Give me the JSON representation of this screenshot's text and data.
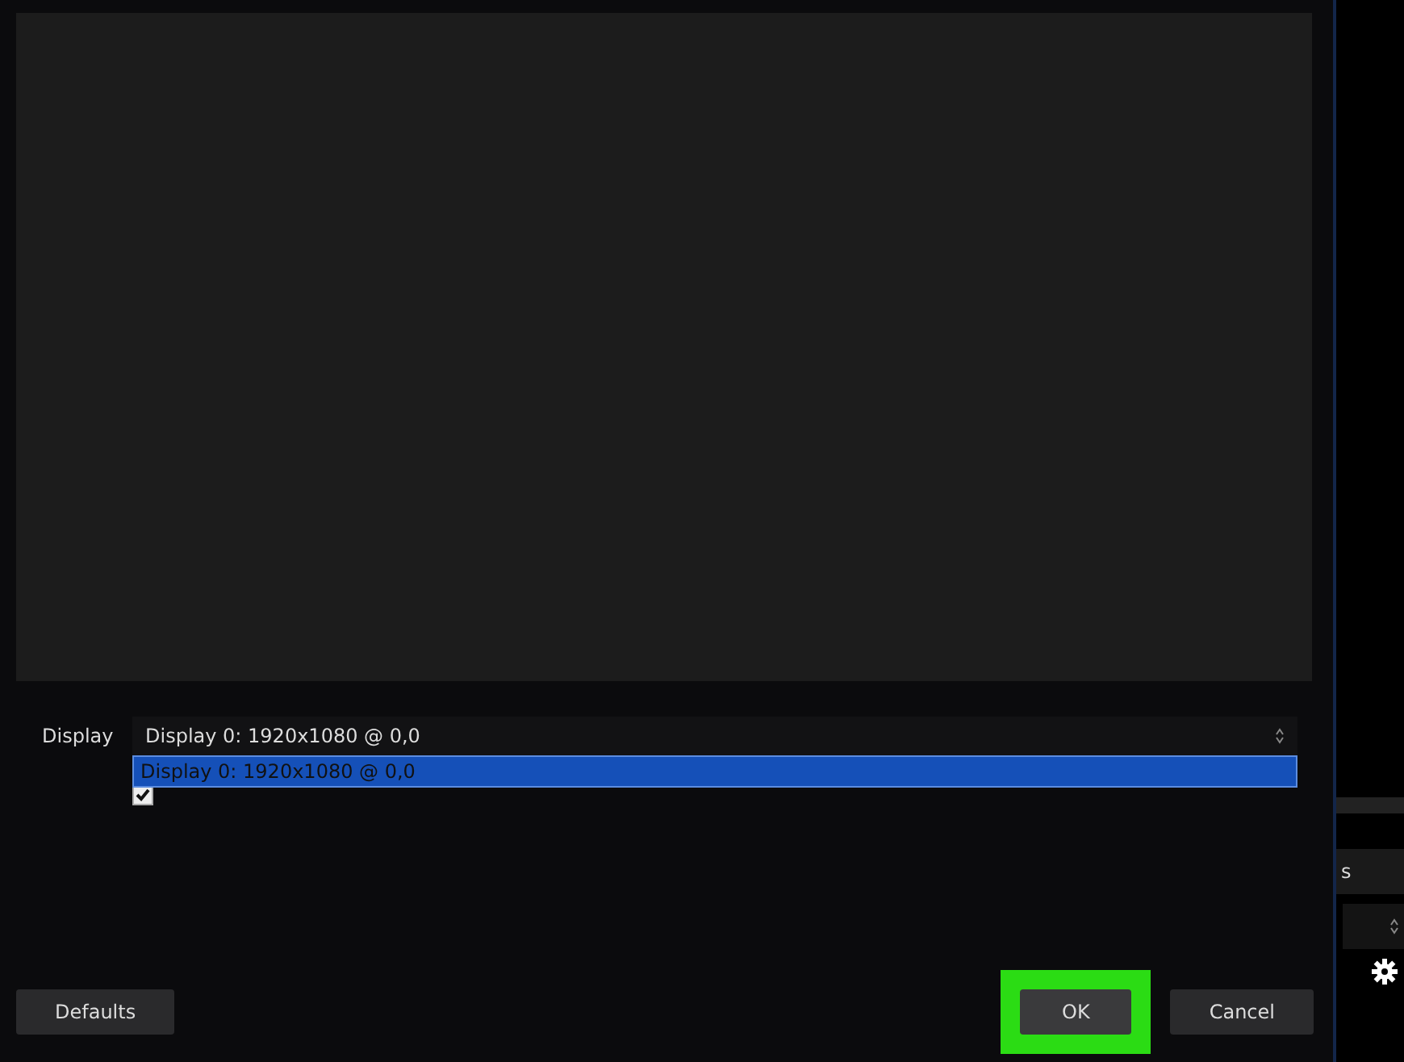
{
  "dialog": {
    "display_label": "Display",
    "display_value": "Display 0: 1920x1080 @ 0,0",
    "dropdown_options": [
      {
        "label": "Display 0: 1920x1080 @ 0,0",
        "selected": true
      }
    ],
    "capture_cursor": {
      "checked": true
    },
    "buttons": [
      {
        "label": "Defaults",
        "highlighted": false
      },
      {
        "label": "OK",
        "highlighted": true
      },
      {
        "label": "Cancel",
        "highlighted": false
      }
    ]
  },
  "background_panel": {
    "field_text": "s"
  }
}
